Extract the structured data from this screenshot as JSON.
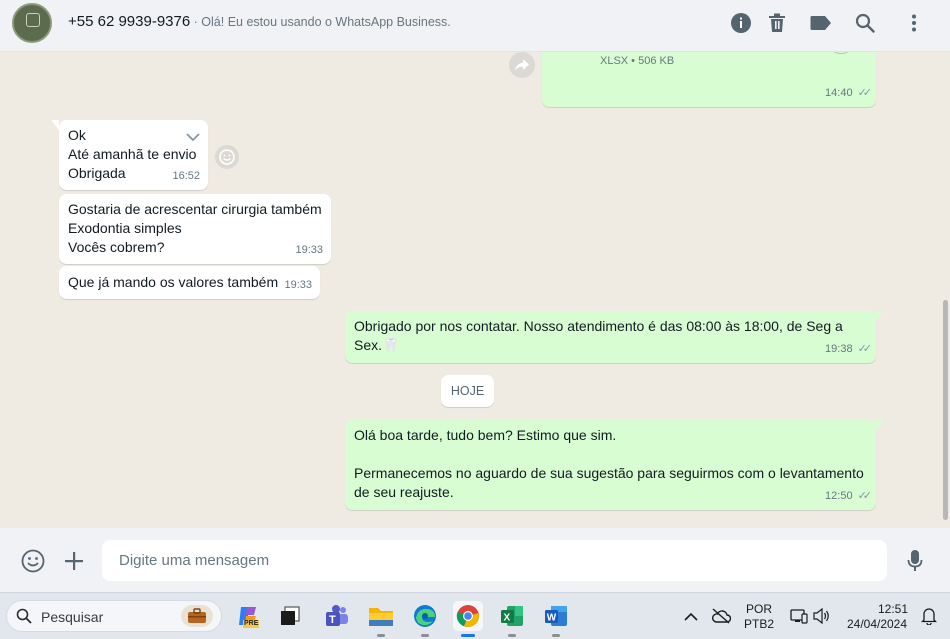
{
  "header": {
    "contact_name": "+55 62 9939-9376",
    "status": " · Olá! Eu estou usando o WhatsApp Business.",
    "icons": [
      "info-icon",
      "trash-icon",
      "label-icon",
      "search-icon",
      "menu-icon"
    ]
  },
  "file_bubble": {
    "meta": "XLSX • 506 KB",
    "time": "14:40"
  },
  "messages": [
    {
      "direction": "in",
      "lines": [
        "Ok",
        "Até amanhã te envio",
        "Obrigada"
      ],
      "time": "16:52"
    },
    {
      "direction": "in",
      "lines": [
        "Gostaria de acrescentar cirurgia também",
        "Exodontia simples",
        "Vocês cobrem?"
      ],
      "time": "19:33"
    },
    {
      "direction": "in",
      "lines": [
        "Que já mando os valores também"
      ],
      "time": "19:33"
    },
    {
      "direction": "out",
      "text": "Obrigado por nos contatar. Nosso atendimento é das 08:00 às 18:00, de Seg a Sex.",
      "emoji": "🦷",
      "time": "19:38"
    },
    {
      "direction": "out",
      "lines": [
        "Olá boa tarde, tudo bem? Estimo que sim.",
        "",
        "Permanecemos no aguardo de sua sugestão para seguirmos com o levantamento de seu reajuste."
      ],
      "time": "12:50"
    }
  ],
  "day_divider": "HOJE",
  "composer": {
    "placeholder": "Digite uma mensagem"
  },
  "taskbar": {
    "search_label": "Pesquisar",
    "language": "POR",
    "keyboard": "PTB2",
    "clock_time": "12:51",
    "clock_date": "24/04/2024",
    "copilot_badge": "PRE",
    "apps": [
      "copilot-icon",
      "task-view-icon",
      "teams-icon",
      "file-explorer-icon",
      "edge-icon",
      "chrome-icon",
      "excel-icon",
      "word-icon"
    ]
  },
  "colors": {
    "outgoing": "#d9fdd3",
    "incoming": "#ffffff",
    "chat_bg": "#efeae2",
    "header_bg": "#f0f2f5"
  }
}
